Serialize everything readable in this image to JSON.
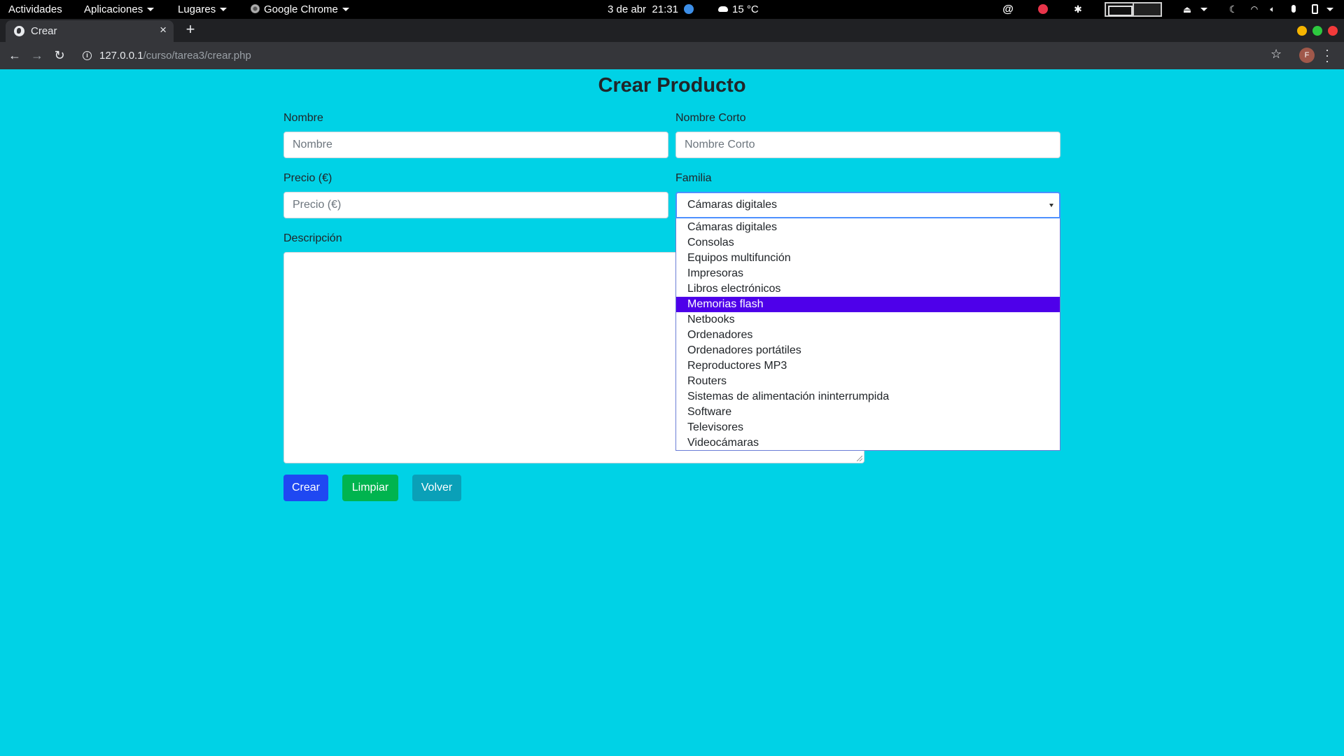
{
  "topbar": {
    "activities": "Actividades",
    "applications": "Aplicaciones",
    "places": "Lugares",
    "app_name": "Google Chrome",
    "date": "3 de abr",
    "time": "21:31",
    "weather": "15 °C",
    "icons": [
      "at-icon",
      "record-icon",
      "gear-icon",
      "eject-icon",
      "night-icon",
      "wifi-icon",
      "volume-icon",
      "mic-icon",
      "battery-icon"
    ]
  },
  "browser": {
    "tab_title": "Crear",
    "url_host": "127.0.0.1",
    "url_path": "/curso/tarea3/crear.php",
    "profile_initial": "F",
    "window_buttons": {
      "minimize": "#f5b400",
      "maximize": "#2dc93f",
      "close": "#f23a3a"
    }
  },
  "form": {
    "title": "Crear Producto",
    "nombre_label": "Nombre",
    "nombre_placeholder": "Nombre",
    "nombre_corto_label": "Nombre Corto",
    "nombre_corto_placeholder": "Nombre Corto",
    "precio_label": "Precio (€)",
    "precio_placeholder": "Precio (€)",
    "familia_label": "Familia",
    "familia_selected": "Cámaras digitales",
    "familia_options": [
      "Cámaras digitales",
      "Consolas",
      "Equipos multifunción",
      "Impresoras",
      "Libros electrónicos",
      "Memorias flash",
      "Netbooks",
      "Ordenadores",
      "Ordenadores portátiles",
      "Reproductores MP3",
      "Routers",
      "Sistemas de alimentación ininterrumpida",
      "Software",
      "Televisores",
      "Videocámaras"
    ],
    "familia_highlighted": "Memorias flash",
    "descripcion_label": "Descripción",
    "descripcion_value": "",
    "buttons": {
      "crear": "Crear",
      "limpiar": "Limpiar",
      "volver": "Volver"
    }
  },
  "colors": {
    "page_background": "#00d2e6",
    "crear_button": "#1f48f2",
    "limpiar_button": "#00b44f",
    "volver_button": "#0aa0b8",
    "option_highlight": "#4e00ea"
  }
}
